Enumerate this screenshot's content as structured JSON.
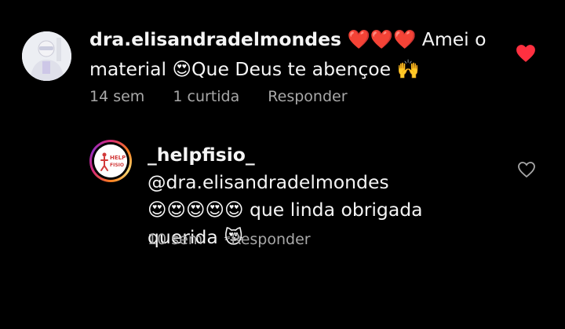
{
  "comment": {
    "username": "dra.elisandradelmondes",
    "text_line1": "❤️❤️❤️ Amei o",
    "text_line2": "material 😍Que Deus te abençoe 🙌",
    "age": "14 sem",
    "likes": "1 curtida",
    "reply_label": "Responder",
    "liked": true,
    "heart_color": "#ff3040"
  },
  "reply": {
    "username": "_helpfisio_",
    "mention": "@dra.elisandradelmondes",
    "text_line2": "😍😍😍😍😍 que linda obrigada",
    "text_line3": "querida 😻",
    "age": "10 sem",
    "reply_label": "Responder",
    "liked": false,
    "avatar_logo_text": "HELP FISIO"
  }
}
